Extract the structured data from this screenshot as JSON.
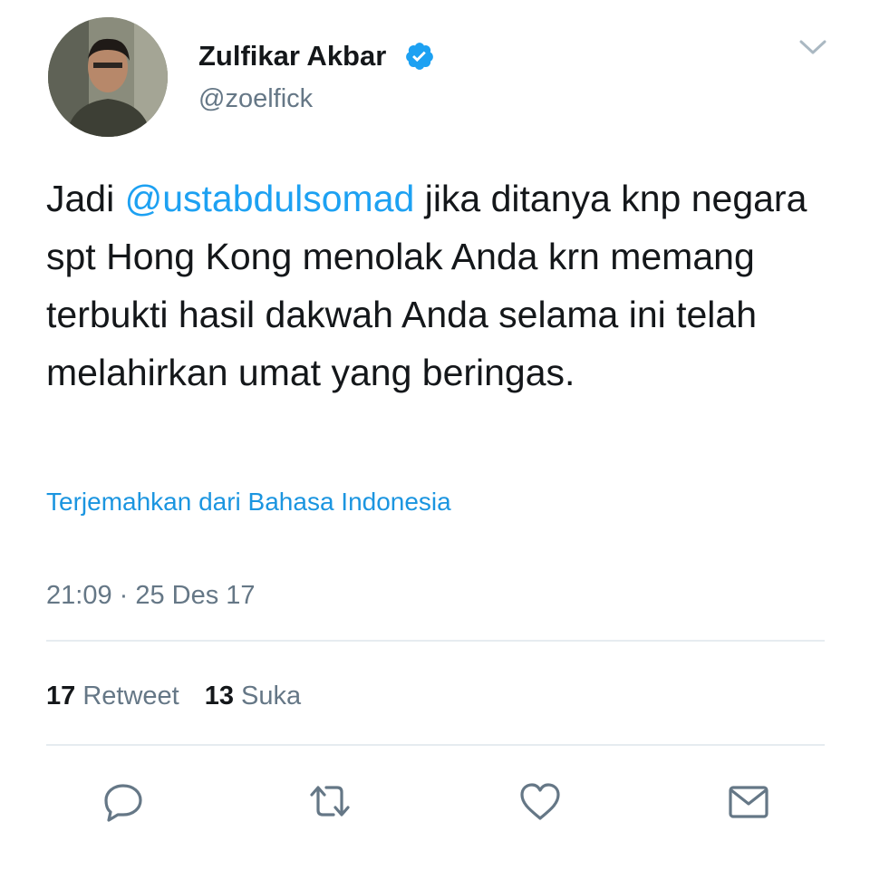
{
  "author": {
    "name": "Zulfikar Akbar",
    "handle": "@zoelfick",
    "verified": true
  },
  "tweet": {
    "text_before": "Jadi ",
    "mention": "@ustabdulsomad",
    "text_after": " jika ditanya knp negara spt Hong Kong menolak Anda krn memang terbukti hasil dakwah Anda selama ini telah melahirkan umat yang beringas.",
    "translate_link": "Terjemahkan dari Bahasa Indonesia",
    "timestamp": "21:09 · 25 Des 17"
  },
  "stats": {
    "retweet_count": "17",
    "retweet_label": "Retweet",
    "like_count": "13",
    "like_label": "Suka"
  },
  "actions": [
    "reply-icon",
    "retweet-icon",
    "like-icon",
    "direct-message-icon"
  ],
  "colors": {
    "accent": "#1da1f2",
    "text": "#14171a",
    "secondary": "#657786"
  }
}
